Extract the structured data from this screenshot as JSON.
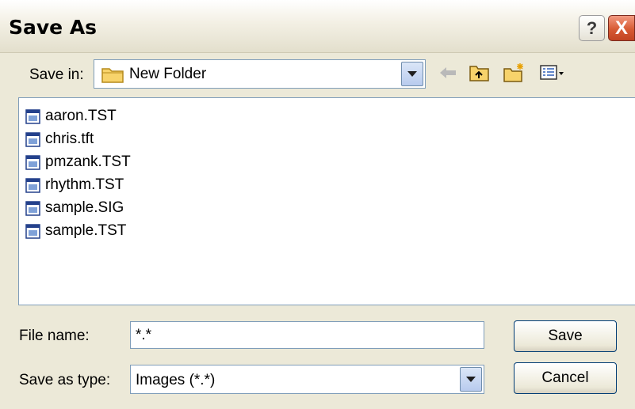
{
  "window": {
    "title": "Save As",
    "help_label": "?",
    "close_label": "X"
  },
  "save_in": {
    "label": "Save in:",
    "value": "New Folder"
  },
  "toolbar": {
    "icons": [
      "back-arrow-icon",
      "up-one-level-icon",
      "new-folder-icon",
      "view-menu-icon"
    ]
  },
  "files": [
    {
      "name": "aaron.TST"
    },
    {
      "name": "chris.tft"
    },
    {
      "name": "pmzank.TST"
    },
    {
      "name": "rhythm.TST"
    },
    {
      "name": "sample.SIG"
    },
    {
      "name": "sample.TST"
    }
  ],
  "file_name": {
    "label": "File name:",
    "value": "*.*"
  },
  "save_as_type": {
    "label": "Save as type:",
    "value": "Images (*.*)"
  },
  "buttons": {
    "save": "Save",
    "cancel": "Cancel"
  },
  "colors": {
    "dialog_bg": "#ece9d8",
    "close_button": "#d75b34",
    "border": "#7f9db9"
  }
}
